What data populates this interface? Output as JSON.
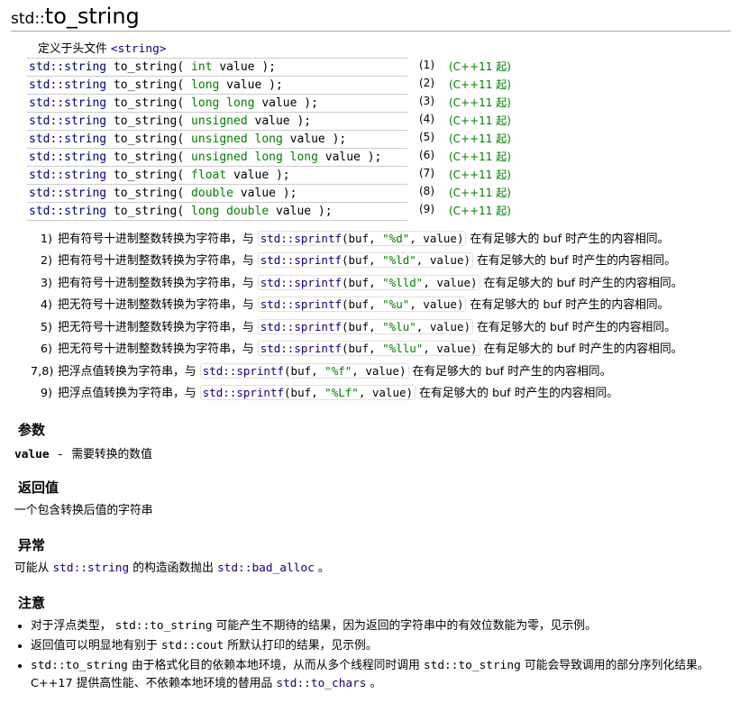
{
  "title_ns": "std::",
  "title_fn": "to_string",
  "header_prefix": "定义于头文件 ",
  "header_link": "<string>",
  "sigs": [
    {
      "ret": "std::string",
      "fn": "to_string",
      "args": [
        [
          "int",
          "value"
        ]
      ],
      "num": "(1)",
      "since": "(C++11 起)"
    },
    {
      "ret": "std::string",
      "fn": "to_string",
      "args": [
        [
          "long",
          "value"
        ]
      ],
      "num": "(2)",
      "since": "(C++11 起)"
    },
    {
      "ret": "std::string",
      "fn": "to_string",
      "args": [
        [
          "long long",
          "value"
        ]
      ],
      "num": "(3)",
      "since": "(C++11 起)"
    },
    {
      "ret": "std::string",
      "fn": "to_string",
      "args": [
        [
          "unsigned",
          "value"
        ]
      ],
      "num": "(4)",
      "since": "(C++11 起)"
    },
    {
      "ret": "std::string",
      "fn": "to_string",
      "args": [
        [
          "unsigned long",
          "value"
        ]
      ],
      "num": "(5)",
      "since": "(C++11 起)"
    },
    {
      "ret": "std::string",
      "fn": "to_string",
      "args": [
        [
          "unsigned long long",
          "value"
        ]
      ],
      "num": "(6)",
      "since": "(C++11 起)"
    },
    {
      "ret": "std::string",
      "fn": "to_string",
      "args": [
        [
          "float",
          "value"
        ]
      ],
      "num": "(7)",
      "since": "(C++11 起)"
    },
    {
      "ret": "std::string",
      "fn": "to_string",
      "args": [
        [
          "double",
          "value"
        ]
      ],
      "num": "(8)",
      "since": "(C++11 起)"
    },
    {
      "ret": "std::string",
      "fn": "to_string",
      "args": [
        [
          "long double",
          "value"
        ]
      ],
      "num": "(9)",
      "since": "(C++11 起)"
    }
  ],
  "descs": [
    {
      "num": "1)",
      "pre": "把有符号十进制整数转换为字符串，与 ",
      "fn": "std::sprintf",
      "mid": "(buf, ",
      "fmt": "\"%d\"",
      "tail": ", value)",
      "post": " 在有足够大的 buf 时产生的内容相同。"
    },
    {
      "num": "2)",
      "pre": "把有符号十进制整数转换为字符串，与 ",
      "fn": "std::sprintf",
      "mid": "(buf, ",
      "fmt": "\"%ld\"",
      "tail": ", value)",
      "post": " 在有足够大的 buf 时产生的内容相同。"
    },
    {
      "num": "3)",
      "pre": "把有符号十进制整数转换为字符串，与 ",
      "fn": "std::sprintf",
      "mid": "(buf, ",
      "fmt": "\"%lld\"",
      "tail": ", value)",
      "post": " 在有足够大的 buf 时产生的内容相同。"
    },
    {
      "num": "4)",
      "pre": "把无符号十进制整数转换为字符串，与 ",
      "fn": "std::sprintf",
      "mid": "(buf, ",
      "fmt": "\"%u\"",
      "tail": ", value)",
      "post": " 在有足够大的 buf 时产生的内容相同。"
    },
    {
      "num": "5)",
      "pre": "把无符号十进制整数转换为字符串，与 ",
      "fn": "std::sprintf",
      "mid": "(buf, ",
      "fmt": "\"%lu\"",
      "tail": ", value)",
      "post": " 在有足够大的 buf 时产生的内容相同。"
    },
    {
      "num": "6)",
      "pre": "把无符号十进制整数转换为字符串，与 ",
      "fn": "std::sprintf",
      "mid": "(buf, ",
      "fmt": "\"%llu\"",
      "tail": ", value)",
      "post": " 在有足够大的 buf 时产生的内容相同。"
    },
    {
      "num": "7,8)",
      "pre": "把浮点值转换为字符串，与 ",
      "fn": "std::sprintf",
      "mid": "(buf, ",
      "fmt": "\"%f\"",
      "tail": ", value)",
      "post": " 在有足够大的 buf 时产生的内容相同。"
    },
    {
      "num": "9)",
      "pre": "把浮点值转换为字符串，与 ",
      "fn": "std::sprintf",
      "mid": "(buf, ",
      "fmt": "\"%Lf\"",
      "tail": ", value)",
      "post": " 在有足够大的 buf 时产生的内容相同。"
    }
  ],
  "sect_params": "参数",
  "param_name": "value",
  "param_dash": "-",
  "param_desc": "需要转换的数值",
  "sect_return": "返回值",
  "return_text": "一个包含转换后值的字符串",
  "sect_except": "异常",
  "except_pre": "可能从 ",
  "except_link1": "std::string",
  "except_mid": " 的构造函数抛出 ",
  "except_link2": "std::bad_alloc",
  "except_post": " 。",
  "sect_notes": "注意",
  "notes": [
    {
      "parts": [
        {
          "t": "对于浮点类型， "
        },
        {
          "c": "std::to_string"
        },
        {
          "t": " 可能产生不期待的结果，因为返回的字符串中的有效位数能为零，见示例。"
        }
      ]
    },
    {
      "parts": [
        {
          "t": "返回值可以明显地有别于 "
        },
        {
          "c": "std::cout"
        },
        {
          "t": " 所默认打印的结果，见示例。"
        }
      ]
    },
    {
      "parts": [
        {
          "c": "std::to_string"
        },
        {
          "t": " 由于格式化目的依赖本地环境，从而从多个线程同时调用 "
        },
        {
          "c": "std::to_string"
        },
        {
          "t": " 可能会导致调用的部分序列化结果。 C++17 提供高性能、不依赖本地环境的替用品 "
        },
        {
          "l": "std::to_chars"
        },
        {
          "t": " 。"
        }
      ]
    }
  ]
}
